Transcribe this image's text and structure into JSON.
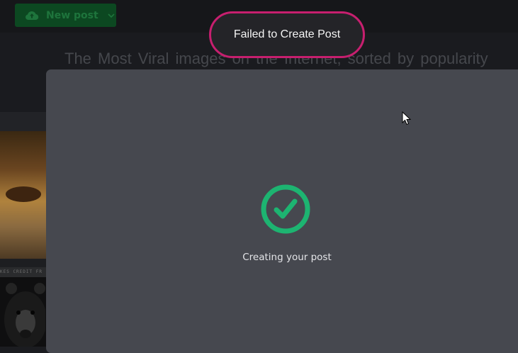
{
  "header": {
    "new_post_label": "New post",
    "new_post_icon": "cloud-upload-icon",
    "dropdown_icon": "chevron-down-icon"
  },
  "hero": {
    "tagline": "The Most Viral images on the Internet, sorted by popularity"
  },
  "gallery": {
    "credit_text": "KES CREDIT FR"
  },
  "modal": {
    "status_icon": "check-circle-icon",
    "status_text": "Creating your post"
  },
  "toast": {
    "message": "Failed to Create Post",
    "border_color": "#c71f6f"
  },
  "colors": {
    "accent_green": "#1db471",
    "new_post_bg": "#0c4b22"
  }
}
